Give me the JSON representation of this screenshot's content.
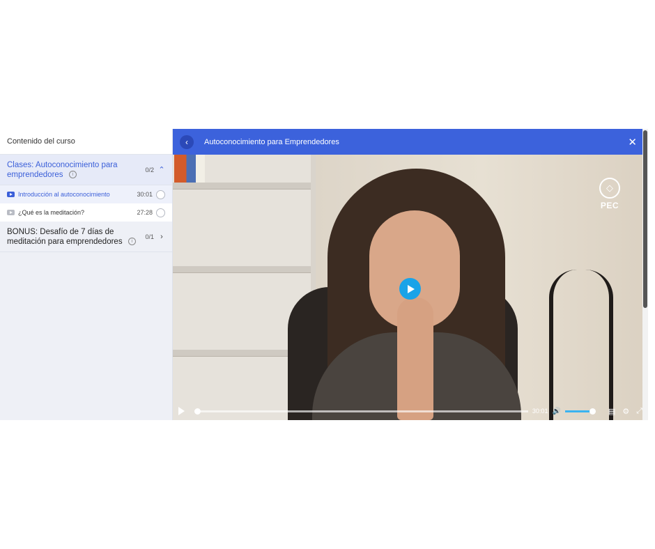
{
  "sidebar": {
    "header": "Contenido del curso",
    "sections": [
      {
        "title": "Clases: Autoconocimiento para emprendedores",
        "count": "0/2",
        "chevron": "chevron-up-icon",
        "lessons": [
          {
            "title": "Introducción al autoconocimiento",
            "duration": "30:01",
            "state": "active"
          },
          {
            "title": "¿Qué es la meditación?",
            "duration": "27:28",
            "state": "normal"
          }
        ]
      },
      {
        "title": "BONUS: Desafío de 7 días de meditación para emprendedores",
        "count": "0/1",
        "chevron": "chevron-right-icon"
      }
    ]
  },
  "player": {
    "title": "Autoconocimiento para Emprendedores",
    "watermark": "PEC",
    "controls": {
      "time": "30:01",
      "progress_fraction": 0,
      "volume_fraction": 1
    }
  },
  "colors": {
    "accent": "#3c62dc",
    "play_button": "#1aa3e8"
  }
}
